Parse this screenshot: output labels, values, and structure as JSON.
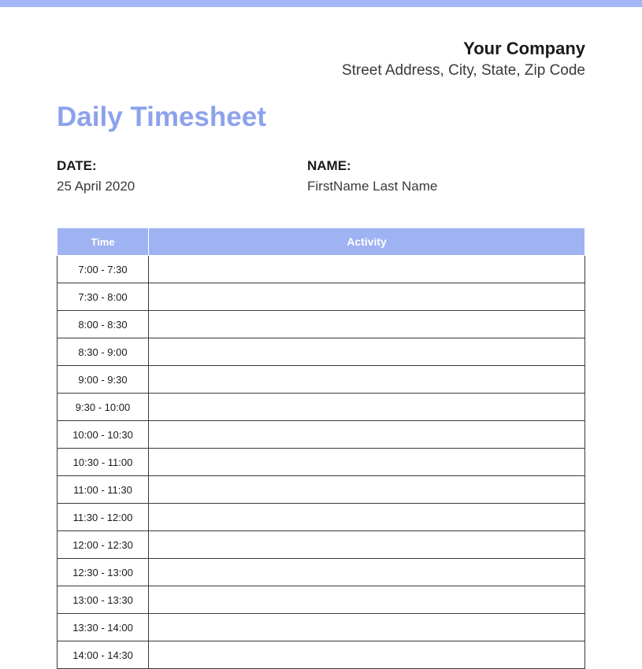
{
  "header": {
    "company_name": "Your Company",
    "company_address": "Street Address, City, State, Zip Code"
  },
  "title": "Daily Timesheet",
  "info": {
    "date_label": "DATE:",
    "date_value": "25 April 2020",
    "name_label": "NAME:",
    "name_value": "FirstName Last Name"
  },
  "table": {
    "headers": {
      "time": "Time",
      "activity": "Activity"
    },
    "rows": [
      {
        "time": "7:00 - 7:30",
        "activity": ""
      },
      {
        "time": "7:30 - 8:00",
        "activity": ""
      },
      {
        "time": "8:00 - 8:30",
        "activity": ""
      },
      {
        "time": "8:30 - 9:00",
        "activity": ""
      },
      {
        "time": "9:00 - 9:30",
        "activity": ""
      },
      {
        "time": "9:30 - 10:00",
        "activity": ""
      },
      {
        "time": "10:00 - 10:30",
        "activity": ""
      },
      {
        "time": "10:30 - 11:00",
        "activity": ""
      },
      {
        "time": "11:00 - 11:30",
        "activity": ""
      },
      {
        "time": "11:30 - 12:00",
        "activity": ""
      },
      {
        "time": "12:00 - 12:30",
        "activity": ""
      },
      {
        "time": "12:30 - 13:00",
        "activity": ""
      },
      {
        "time": "13:00 - 13:30",
        "activity": ""
      },
      {
        "time": "13:30 - 14:00",
        "activity": ""
      },
      {
        "time": "14:00 - 14:30",
        "activity": ""
      }
    ]
  }
}
